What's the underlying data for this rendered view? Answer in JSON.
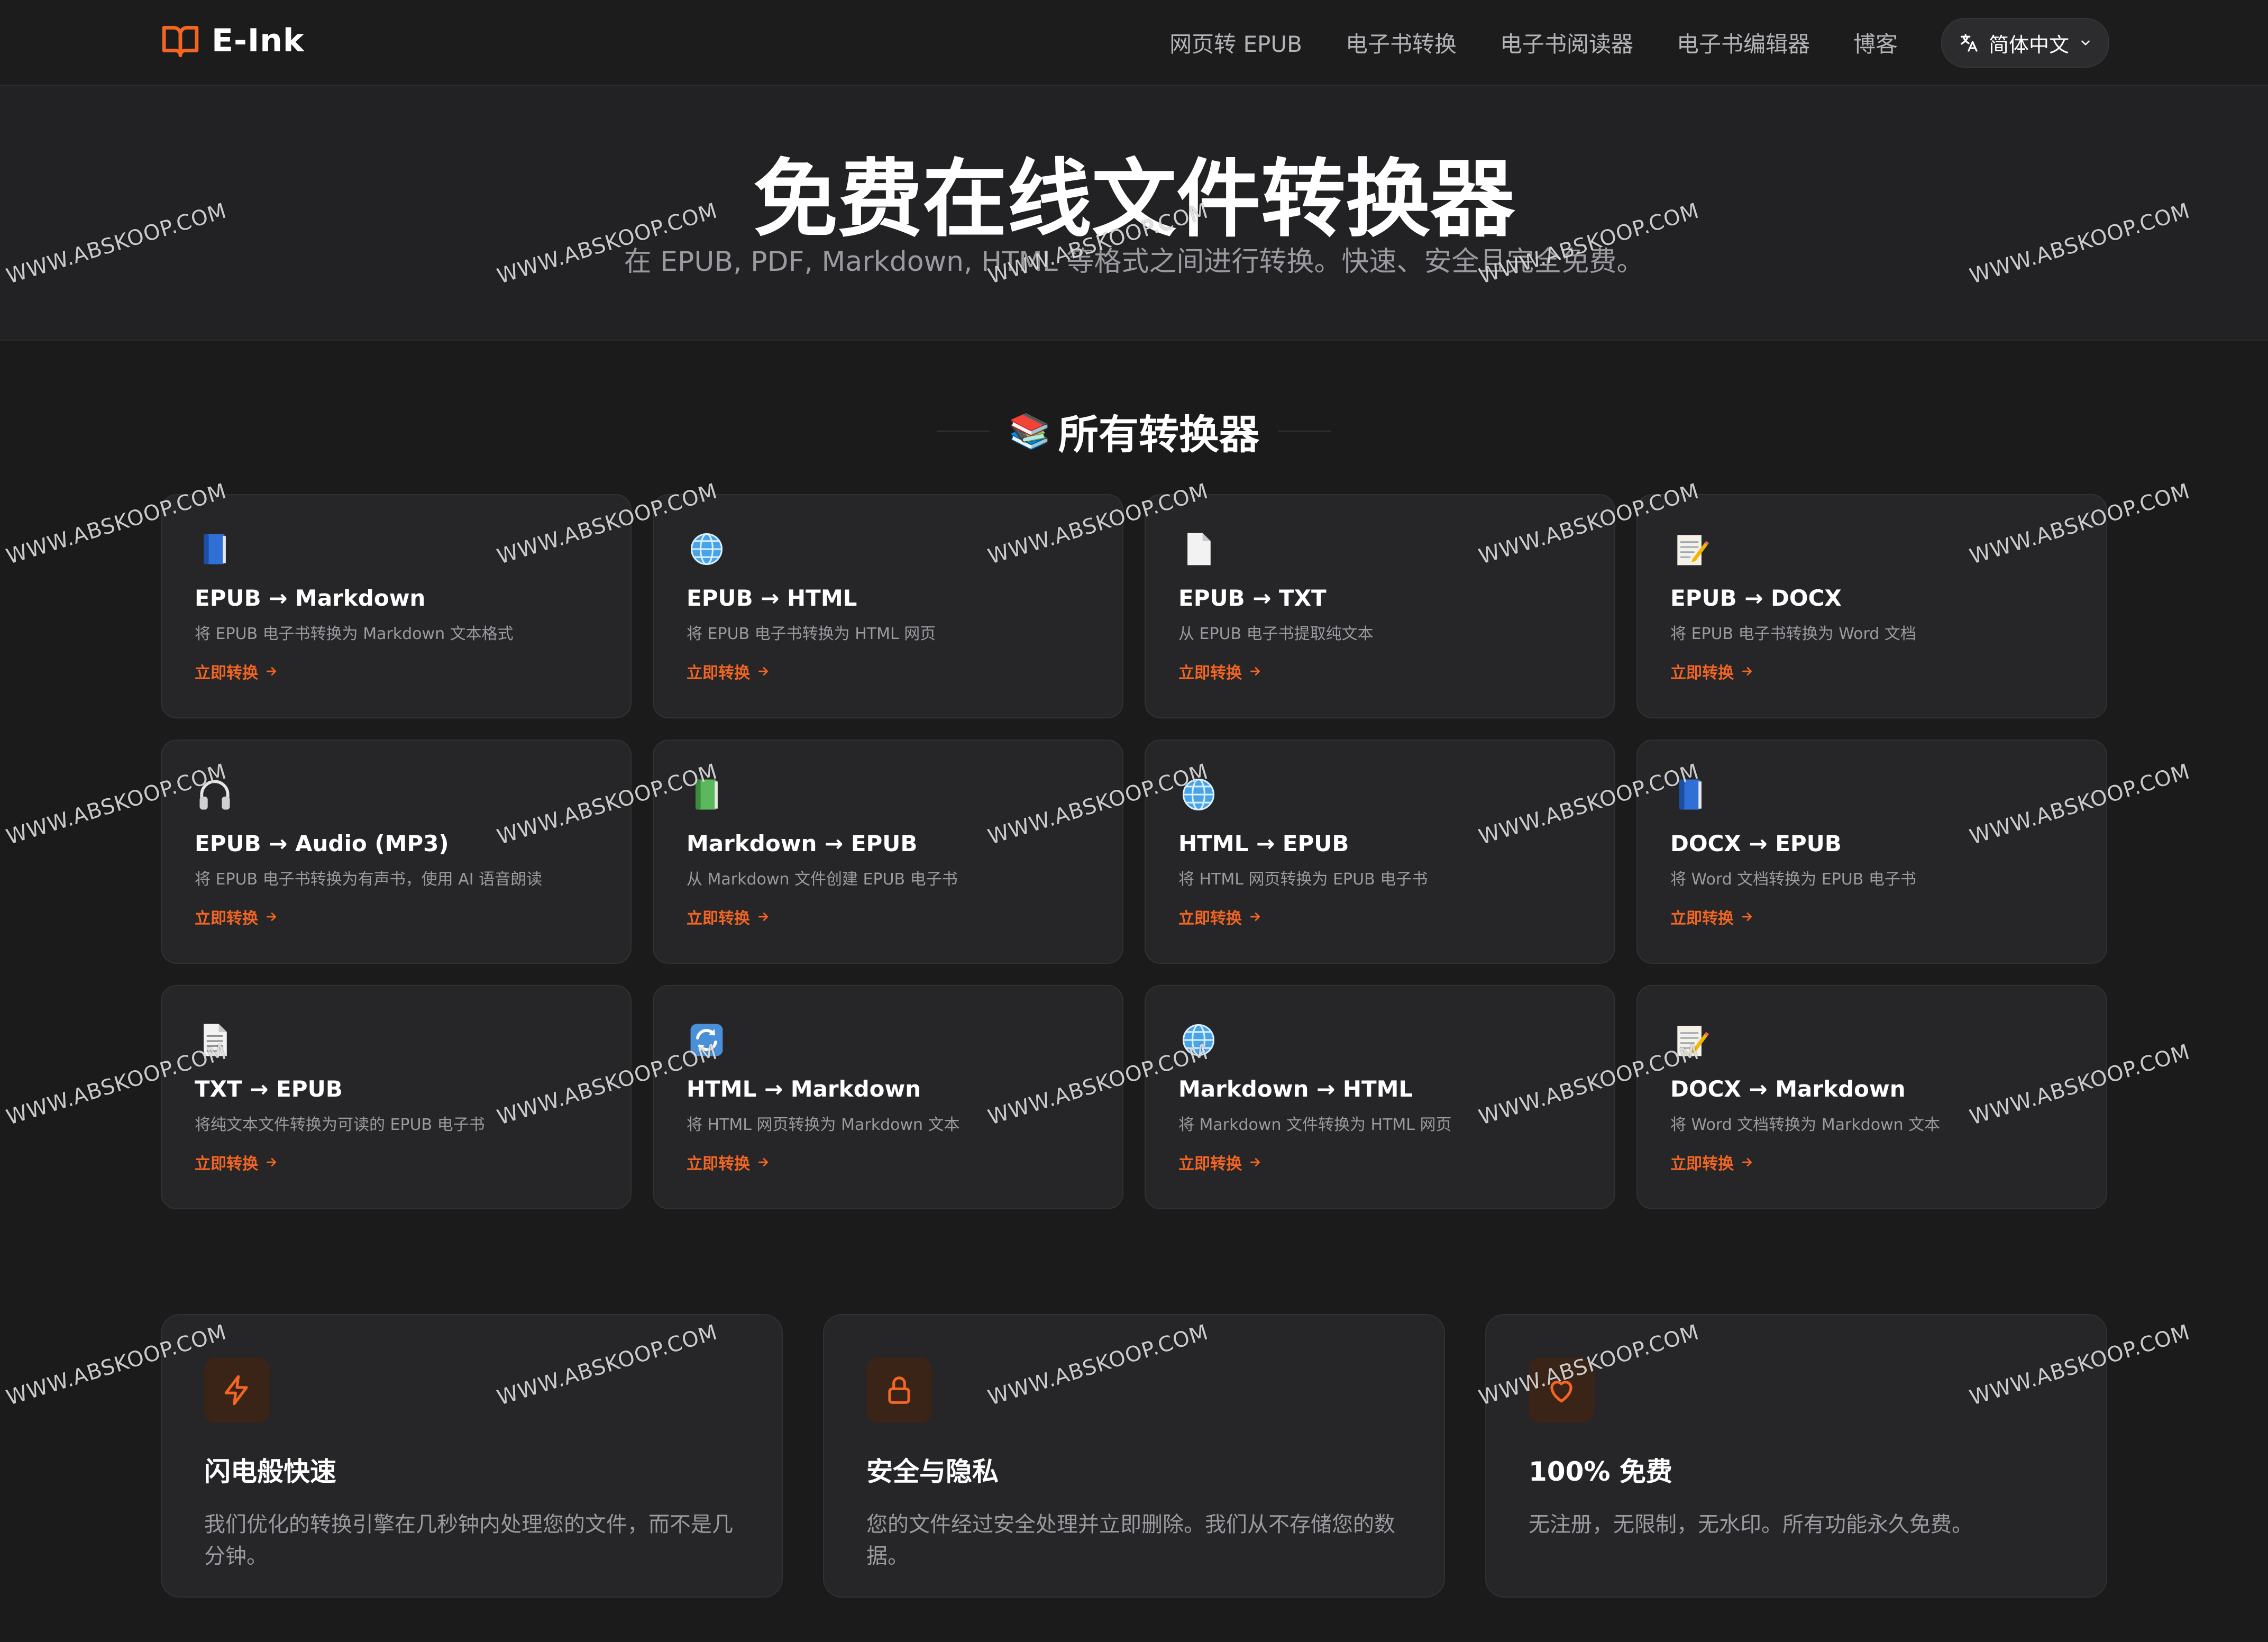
{
  "header": {
    "logo_text": "E-Ink",
    "nav": [
      "网页转 EPUB",
      "电子书转换",
      "电子书阅读器",
      "电子书编辑器",
      "博客"
    ],
    "language": "简体中文"
  },
  "hero": {
    "title": "免费在线文件转换器",
    "subtitle": "在 EPUB, PDF, Markdown, HTML 等格式之间进行转换。快速、安全且完全免费。"
  },
  "section": {
    "icon": "📚",
    "title": "所有转换器"
  },
  "converters": [
    {
      "icon": "blue-book-icon",
      "title": "EPUB → Markdown",
      "desc": "将 EPUB 电子书转换为 Markdown 文本格式",
      "link": "立即转换"
    },
    {
      "icon": "globe-icon",
      "title": "EPUB → HTML",
      "desc": "将 EPUB 电子书转换为 HTML 网页",
      "link": "立即转换"
    },
    {
      "icon": "page-icon",
      "title": "EPUB → TXT",
      "desc": "从 EPUB 电子书提取纯文本",
      "link": "立即转换"
    },
    {
      "icon": "memo-icon",
      "title": "EPUB → DOCX",
      "desc": "将 EPUB 电子书转换为 Word 文档",
      "link": "立即转换"
    },
    {
      "icon": "headphones-icon",
      "title": "EPUB → Audio (MP3)",
      "desc": "将 EPUB 电子书转换为有声书，使用 AI 语音朗读",
      "link": "立即转换"
    },
    {
      "icon": "green-book-icon",
      "title": "Markdown → EPUB",
      "desc": "从 Markdown 文件创建 EPUB 电子书",
      "link": "立即转换"
    },
    {
      "icon": "globe-icon",
      "title": "HTML → EPUB",
      "desc": "将 HTML 网页转换为 EPUB 电子书",
      "link": "立即转换"
    },
    {
      "icon": "blue-book-icon",
      "title": "DOCX → EPUB",
      "desc": "将 Word 文档转换为 EPUB 电子书",
      "link": "立即转换"
    },
    {
      "icon": "text-file-icon",
      "title": "TXT → EPUB",
      "desc": "将纯文本文件转换为可读的 EPUB 电子书",
      "link": "立即转换"
    },
    {
      "icon": "refresh-icon",
      "title": "HTML → Markdown",
      "desc": "将 HTML 网页转换为 Markdown 文本",
      "link": "立即转换"
    },
    {
      "icon": "globe-icon",
      "title": "Markdown → HTML",
      "desc": "将 Markdown 文件转换为 HTML 网页",
      "link": "立即转换"
    },
    {
      "icon": "memo-icon",
      "title": "DOCX → Markdown",
      "desc": "将 Word 文档转换为 Markdown 文本",
      "link": "立即转换"
    }
  ],
  "features": [
    {
      "icon": "lightning-icon",
      "title": "闪电般快速",
      "desc": "我们优化的转换引擎在几秒钟内处理您的文件，而不是几分钟。"
    },
    {
      "icon": "lock-icon",
      "title": "安全与隐私",
      "desc": "您的文件经过安全处理并立即删除。我们从不存储您的数据。"
    },
    {
      "icon": "heart-icon",
      "title": "100% 免费",
      "desc": "无注册，无限制，无水印。所有功能永久免费。"
    }
  ],
  "watermark": "WWW.ABSKOOP.COM",
  "colors": {
    "accent": "#f26522",
    "background": "#1b1b1c",
    "card": "#262628",
    "muted_text": "#9a9aa0"
  }
}
